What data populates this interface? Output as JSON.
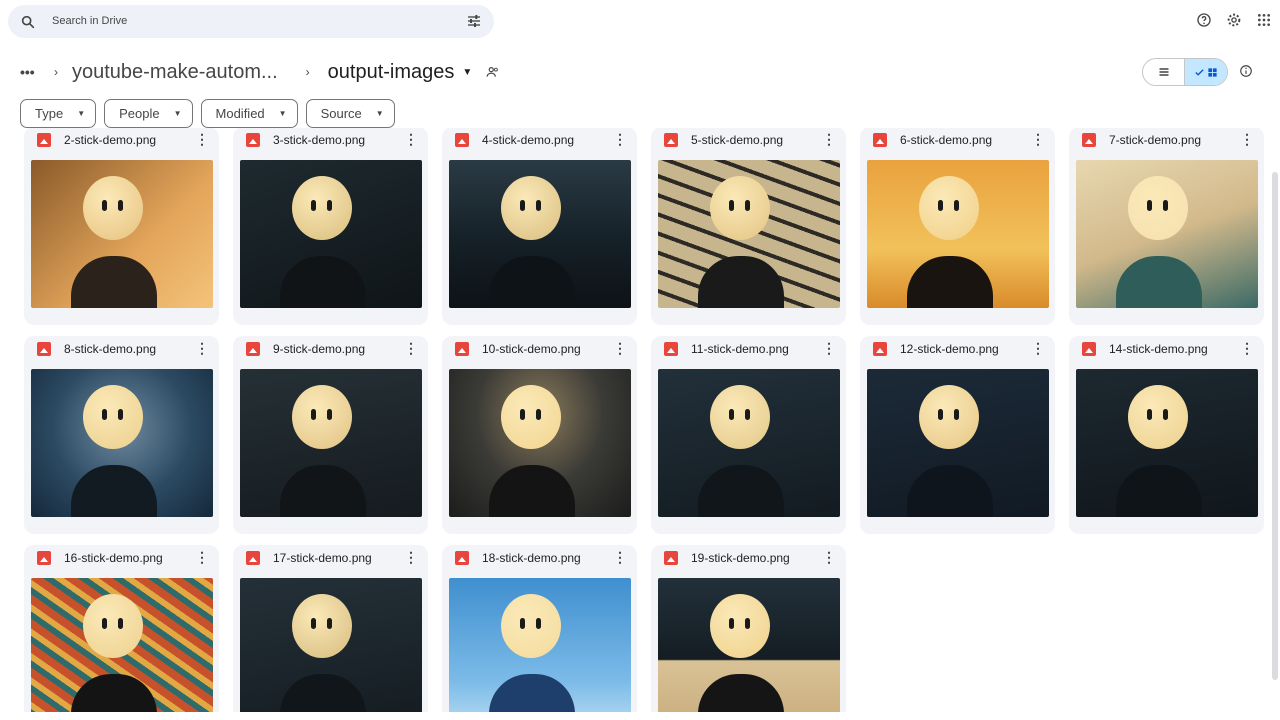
{
  "search": {
    "placeholder": "Search in Drive"
  },
  "breadcrumb": {
    "more": "•••",
    "parent": "youtube-make-autom...",
    "current": "output-images"
  },
  "filters": [
    "Type",
    "People",
    "Modified",
    "Source"
  ],
  "files": [
    {
      "name": "2-stick-demo.png",
      "bg": "linear-gradient(135deg,#8a5a2a,#e3a55a 60%,#f3c37a)",
      "face": "#e7c27e",
      "body": "#2b221b"
    },
    {
      "name": "3-stick-demo.png",
      "bg": "linear-gradient(160deg,#1e2a30,#0f1518)",
      "face": "#d9bd7c",
      "body": "#101417"
    },
    {
      "name": "4-stick-demo.png",
      "bg": "linear-gradient(180deg,#2a3a44,#152027 55%,#0d1216)",
      "face": "#d8bd7f",
      "body": "#0e1317"
    },
    {
      "name": "5-stick-demo.png",
      "bg": "repeating-linear-gradient(20deg,#c7b58e 0 14px,#2d2a26 14px 18px)",
      "face": "#e3c482",
      "body": "#1a1a1a"
    },
    {
      "name": "6-stick-demo.png",
      "bg": "linear-gradient(180deg,#e9a23e,#f2c15a 60%,#d98b2a)",
      "face": "#f0cf85",
      "body": "#1a1410"
    },
    {
      "name": "7-stick-demo.png",
      "bg": "linear-gradient(160deg,#e7d7b0,#d2b98b 50%,#3b6a66)",
      "face": "#f5e0ae",
      "body": "#2f5d59"
    },
    {
      "name": "8-stick-demo.png",
      "bg": "radial-gradient(circle at 50% 40%,#6f8aa0,#2b4a62 55%,#16283a)",
      "face": "#ebcf8c",
      "body": "#121a22"
    },
    {
      "name": "9-stick-demo.png",
      "bg": "linear-gradient(170deg,#253036,#151b1f)",
      "face": "#e0c283",
      "body": "#121518"
    },
    {
      "name": "10-stick-demo.png",
      "bg": "radial-gradient(ellipse at 50% 30%,#8a7a5a,#3a3a36 50%,#1c1c1c)",
      "face": "#f1d58f",
      "body": "#141414"
    },
    {
      "name": "11-stick-demo.png",
      "bg": "linear-gradient(170deg,#22303a,#131b21)",
      "face": "#e2c888",
      "body": "#10161a"
    },
    {
      "name": "12-stick-demo.png",
      "bg": "linear-gradient(170deg,#1c2a38,#111a24)",
      "face": "#e6c683",
      "body": "#0f151c"
    },
    {
      "name": "14-stick-demo.png",
      "bg": "linear-gradient(170deg,#1d2830,#10171c)",
      "face": "#ecd08e",
      "body": "#0f1418"
    },
    {
      "name": "16-stick-demo.png",
      "bg": "repeating-linear-gradient(35deg,#c6512a 0 8px,#2f6b6a 8px 14px,#e2a844 14px 20px)",
      "face": "#edd08d",
      "body": "#141414"
    },
    {
      "name": "17-stick-demo.png",
      "bg": "linear-gradient(170deg,#243038,#141c21)",
      "face": "#d6bb7d",
      "body": "#10161a"
    },
    {
      "name": "18-stick-demo.png",
      "bg": "linear-gradient(180deg,#3f8fcf,#7cbbe8 70%,#b6dbf2)",
      "face": "#f3db9c",
      "body": "#1e3e6b"
    },
    {
      "name": "19-stick-demo.png",
      "bg": "linear-gradient(180deg,#22303a,#151d23 55%,#d9c296 56%,#c8ad7d)",
      "face": "#efd08a",
      "body": "#151515"
    }
  ],
  "colors": {
    "accent": "#c2e7ff",
    "file_icon": "#e8453c",
    "card_bg": "#f2f4f8"
  },
  "icons": [
    "search-icon",
    "tune-icon",
    "help-icon",
    "settings-icon",
    "apps-icon",
    "people-icon",
    "list-view-icon",
    "grid-view-icon",
    "info-icon",
    "image-file-icon",
    "more-vert-icon"
  ]
}
